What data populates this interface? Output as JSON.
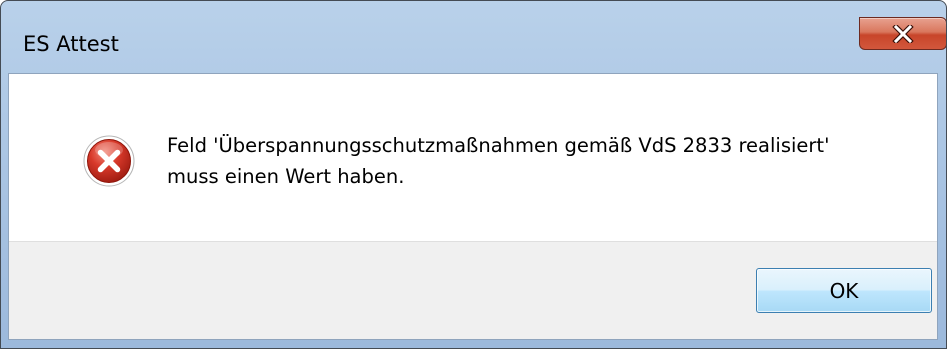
{
  "window": {
    "title": "ES Attest",
    "close_label": "Close"
  },
  "message": {
    "line1": "Feld 'Überspannungsschutzmaßnahmen gemäß VdS 2833 realisiert'",
    "line2": "muss einen Wert haben.",
    "icon": "error-icon"
  },
  "buttons": {
    "ok_label": "OK"
  },
  "colors": {
    "title_bar": "#a9c4e3",
    "close_button": "#c8452a",
    "footer": "#f0f0f0",
    "ok_border": "#3c7fb1",
    "error_icon": "#c42b1c"
  }
}
